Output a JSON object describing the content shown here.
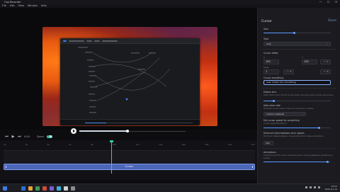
{
  "window": {
    "title": "Cap Recorder",
    "controls": [
      "—",
      "☐",
      "✕"
    ]
  },
  "menu": [
    "File",
    "Edit",
    "View",
    "Window",
    "Help"
  ],
  "playback": {
    "progress": 0.45
  },
  "timeline_toolbar": {
    "icons": [
      "skip-back-icon",
      "play-icon",
      "skip-forward-icon"
    ],
    "time": "0:00",
    "zoom_label": "Zoom",
    "zoom_on": true,
    "right_controls": [
      "↶",
      "↷",
      "⤢",
      "✂",
      "+"
    ]
  },
  "ruler": [
    "0s",
    "2s",
    "4s",
    "6s",
    "8s",
    "10s",
    "12s",
    "14s",
    "16s",
    "18s",
    "20s",
    "22s"
  ],
  "clip": {
    "label": "Screen"
  },
  "panel": {
    "title": "Cursor",
    "close": "Done",
    "size": {
      "label": "Size",
      "value": 0.45
    },
    "type": {
      "label": "Type",
      "value": "Auto"
    },
    "hotspot": {
      "label": "Cursor offset",
      "x_label": "X",
      "y_label": "Y",
      "x": "100",
      "y": "100",
      "extra_label": "Scale",
      "scale": "1",
      "pm": "− +"
    },
    "smoothing": {
      "label": "Cursor smoothing",
      "value": "auto motion blur smoothing"
    },
    "motion_blur": {
      "label": "Motion blur",
      "hint": "Adds motion blur to the cursor while moving quickly across the screen",
      "value": 0.15
    },
    "hide_idle": {
      "label": "Hide when idle",
      "hint": "Hide the cursor when it has not moved for a while",
      "value": "Custom (default)"
    },
    "opacity": {
      "label": "Min cursor speed for smoothing",
      "hint": "Cursor speed threshold",
      "value": 0.82
    },
    "click_ripple": {
      "label": "Minimum time between click ripples",
      "hint": "Minimum delay between consecutive click ripple animations",
      "value": "200"
    },
    "animation": {
      "label": "Animations",
      "hint": "Controls how the cursor animates when moving between positions on screen",
      "value": 0.95
    }
  },
  "taskbar": {
    "time": "10:52",
    "date": "2024-01-15",
    "apps": [
      "#2b6fd6",
      "#e8a23a",
      "#3a9b5a",
      "#d04a3a",
      "#7a5ad0",
      "#3ab0d8",
      "#cfcfcf",
      "#8a8a90"
    ]
  }
}
